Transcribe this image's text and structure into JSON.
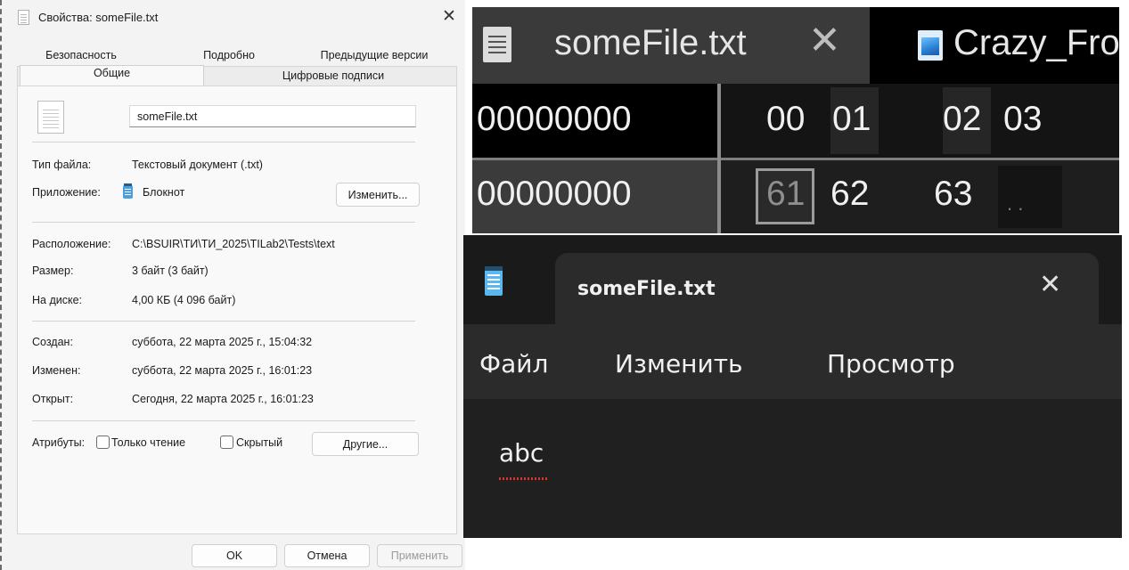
{
  "properties_dialog": {
    "title": "Свойства: someFile.txt",
    "tabs_row1": [
      "Безопасность",
      "Подробно",
      "Предыдущие версии"
    ],
    "tabs_row2": [
      "Общие",
      "Цифровые подписи"
    ],
    "file_name": "someFile.txt",
    "rows": {
      "file_type_label": "Тип файла:",
      "file_type_value": "Текстовый документ (.txt)",
      "app_label": "Приложение:",
      "app_value": "Блокнот",
      "change_button": "Изменить...",
      "location_label": "Расположение:",
      "location_value": "C:\\BSUIR\\ТИ\\ТИ_2025\\TILab2\\Tests\\text",
      "size_label": "Размер:",
      "size_value": "3 байт (3 байт)",
      "disk_label": "На диске:",
      "disk_value": "4,00 КБ (4 096 байт)",
      "created_label": "Создан:",
      "created_value": "суббота, 22 марта 2025 г., 15:04:32",
      "modified_label": "Изменен:",
      "modified_value": "суббота, 22 марта 2025 г., 16:01:23",
      "opened_label": "Открыт:",
      "opened_value": "Сегодня, 22 марта 2025 г., 16:01:23"
    },
    "attributes_label": "Атрибуты:",
    "readonly_label": "Только чтение",
    "hidden_label": "Скрытый",
    "other_button": "Другие...",
    "ok_button": "OK",
    "cancel_button": "Отмена",
    "apply_button": "Применить"
  },
  "hex_editor": {
    "tab1": "someFile.txt",
    "tab2": "Crazy_Fro",
    "header_offset": "00000000",
    "header_cols": [
      "00",
      "01",
      "02",
      "03"
    ],
    "row_offset": "00000000",
    "row_bytes": [
      "61",
      "62",
      "63",
      ". ."
    ]
  },
  "notepad": {
    "tab_title": "someFile.txt",
    "menu": [
      "Файл",
      "Изменить",
      "Просмотр"
    ],
    "content": "abc"
  },
  "colors": {
    "dialog_bg": "#f3f3f3",
    "hex_bg": "#1e1e1e",
    "notepad_bg": "#202020",
    "notepad_icon": "#58b8ef",
    "spellcheck": "#e0312b"
  }
}
